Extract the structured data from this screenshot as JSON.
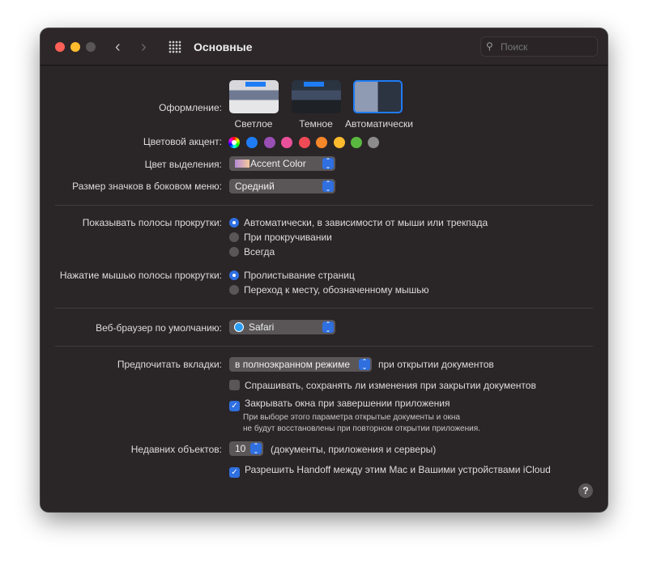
{
  "window": {
    "title": "Основные",
    "search_placeholder": "Поиск"
  },
  "appearance": {
    "label": "Оформление:",
    "options": [
      {
        "label": "Светлое",
        "selected": false
      },
      {
        "label": "Темное",
        "selected": false
      },
      {
        "label": "Автоматически",
        "selected": true
      }
    ]
  },
  "accent": {
    "label": "Цветовой акцент:",
    "colors": [
      "multicolor",
      "#1f7cf4",
      "#9a4fb5",
      "#e9509a",
      "#ef4a56",
      "#f5862a",
      "#fbbb2c",
      "#5ab840",
      "#8c8c8c"
    ],
    "selected": 0
  },
  "highlight": {
    "label": "Цвет выделения:",
    "value": "Accent Color"
  },
  "sidebar_size": {
    "label": "Размер значков в боковом меню:",
    "value": "Средний"
  },
  "scrollbars": {
    "label": "Показывать полосы прокрутки:",
    "options": [
      "Автоматически, в зависимости от мыши или трекпада",
      "При прокручивании",
      "Всегда"
    ],
    "selected": 0
  },
  "scroll_click": {
    "label": "Нажатие мышью полосы прокрутки:",
    "options": [
      "Пролистывание страниц",
      "Переход к месту, обозначенному мышью"
    ],
    "selected": 0
  },
  "browser": {
    "label": "Веб-браузер по умолчанию:",
    "value": "Safari"
  },
  "tabs": {
    "label": "Предпочитать вкладки:",
    "value": "в полноэкранном режиме",
    "suffix": "при открытии документов"
  },
  "ask_save": {
    "label": "Спрашивать, сохранять ли изменения при закрытии документов",
    "checked": false
  },
  "close_windows": {
    "label": "Закрывать окна при завершении приложения",
    "checked": true,
    "note1": "При выборе этого параметра открытые документы и окна",
    "note2": "не будут восстановлены при повторном открытии приложения."
  },
  "recent": {
    "label": "Недавних объектов:",
    "value": "10",
    "suffix": "(документы, приложения и серверы)"
  },
  "handoff": {
    "label": "Разрешить Handoff между этим Mac и Вашими устройствами iCloud",
    "checked": true
  },
  "help": "?"
}
